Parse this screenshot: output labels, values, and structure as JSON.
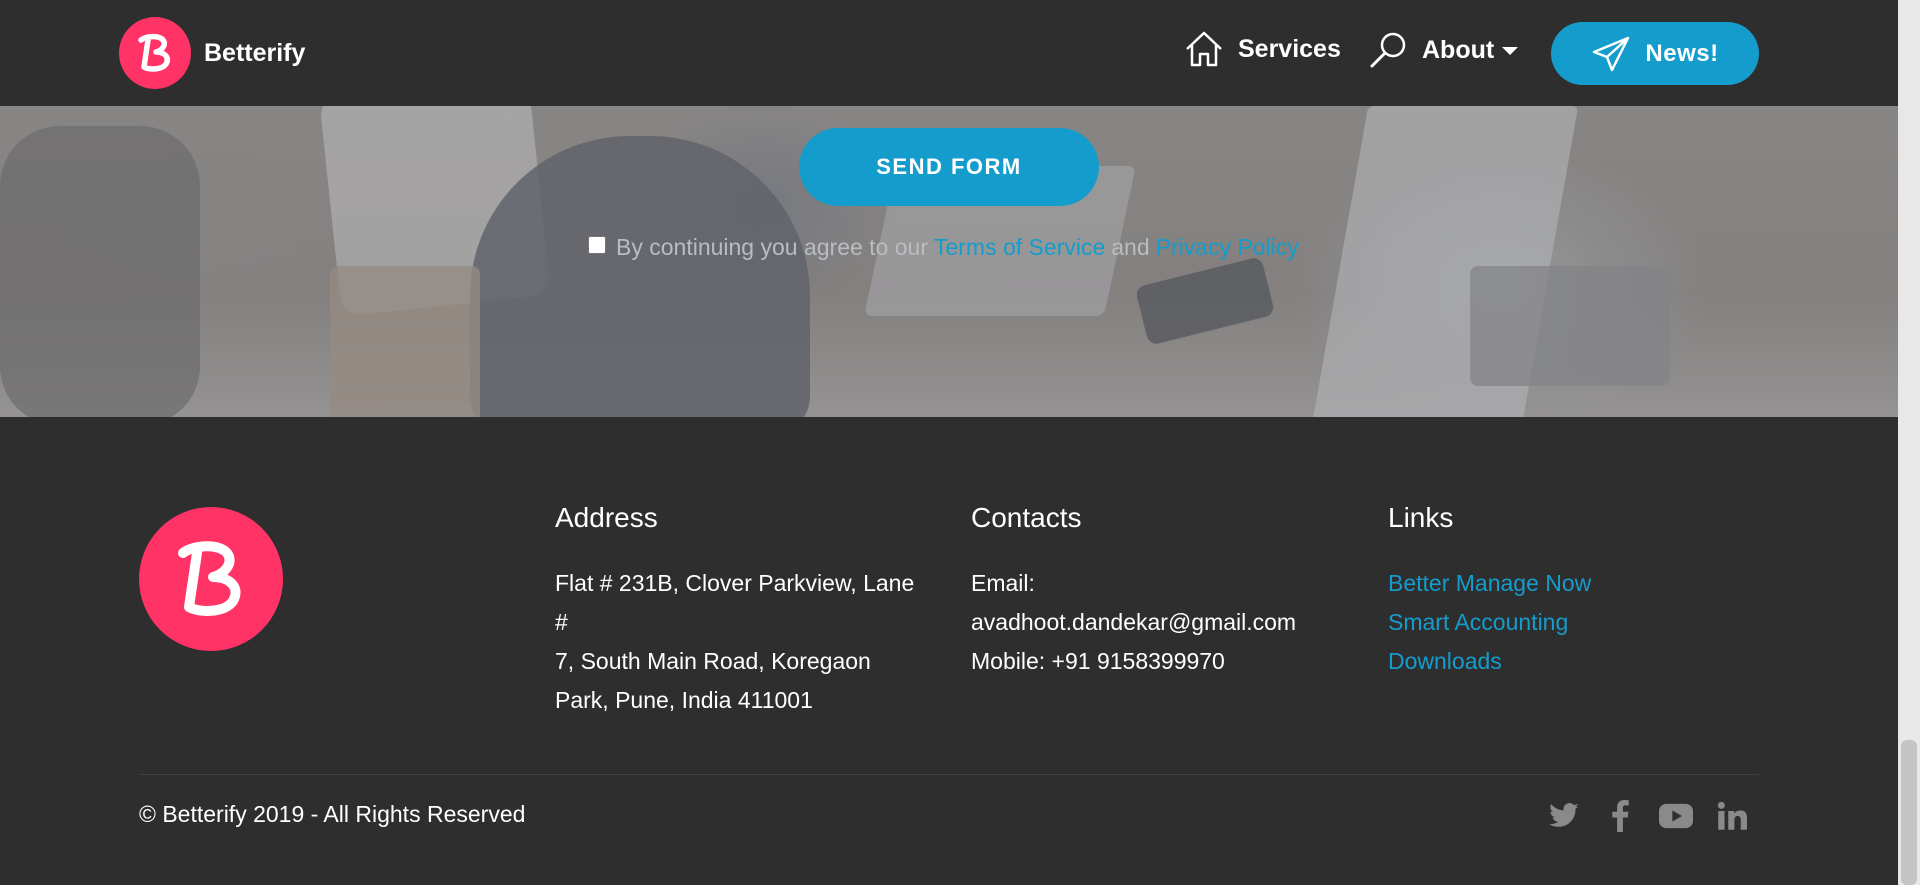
{
  "nav": {
    "brand": "Betterify",
    "services": "Services",
    "about": "About",
    "news": "News!"
  },
  "form": {
    "send_label": "SEND FORM",
    "agree_prefix": "By continuing you agree to our",
    "terms": "Terms of Service",
    "and": "and",
    "privacy": "Privacy Policy"
  },
  "footer": {
    "address": {
      "title": "Address",
      "lines": [
        "Flat # 231B, Clover Parkview, Lane #",
        "7, South Main Road, Koregaon",
        "Park, Pune, India 411001"
      ]
    },
    "contacts": {
      "title": "Contacts",
      "email_label": "Email:",
      "email": "avadhoot.dandekar@gmail.com",
      "mobile": "Mobile: +91 9158399970"
    },
    "links": {
      "title": "Links",
      "items": [
        "Better Manage Now",
        "Smart Accounting",
        "Downloads"
      ]
    },
    "copyright": "© Betterify 2019 - All Rights Reserved",
    "socials": [
      "twitter-icon",
      "facebook-icon",
      "youtube-icon",
      "linkedin-icon"
    ]
  },
  "colors": {
    "accent": "#149dcc",
    "brand": "#ff3366",
    "background": "#2e2e2e"
  }
}
